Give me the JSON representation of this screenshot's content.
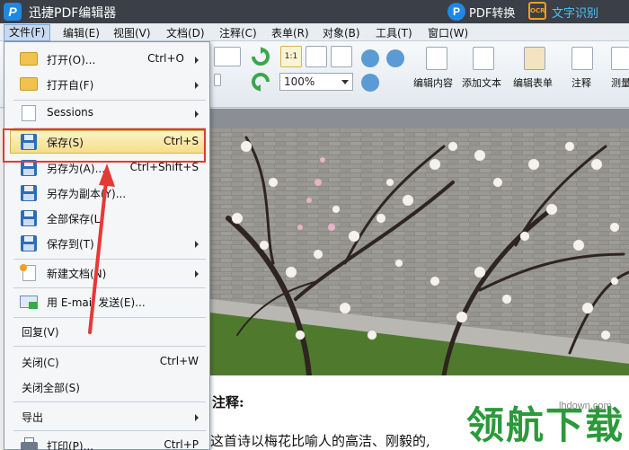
{
  "titlebar": {
    "app_title": "迅捷PDF编辑器",
    "logo_glyph": "P",
    "pdf_convert_label": "PDF转换",
    "pdf_convert_glyph": "P",
    "ocr_glyph": "OCR",
    "ocr_label": "文字识别"
  },
  "menubar": {
    "items": [
      "文件(F)",
      "编辑(E)",
      "视图(V)",
      "文档(D)",
      "注释(C)",
      "表单(R)",
      "对象(B)",
      "工具(T)",
      "窗口(W)"
    ]
  },
  "toolbar": {
    "zoom_value": "100%",
    "zoom_fit_label": "1:1",
    "edit_content_label": "编辑内容",
    "add_text_label": "添加文本",
    "edit_form_label": "编辑表单",
    "annotate_label": "注释",
    "measure_label": "测量"
  },
  "file_menu": {
    "items": [
      {
        "label": "打开(O)...",
        "shortcut": "Ctrl+O",
        "submenu": true
      },
      {
        "label": "打开自(F)",
        "shortcut": "",
        "submenu": true
      },
      {
        "label": "Sessions",
        "shortcut": "",
        "submenu": true
      },
      {
        "label": "保存(S)",
        "shortcut": "Ctrl+S",
        "submenu": false
      },
      {
        "label": "另存为(A)...",
        "shortcut": "Ctrl+Shift+S",
        "submenu": false
      },
      {
        "label": "另存为副本(Y)...",
        "shortcut": "",
        "submenu": false
      },
      {
        "label": "全部保存(L)",
        "shortcut": "",
        "submenu": false
      },
      {
        "label": "保存到(T)",
        "shortcut": "",
        "submenu": true
      },
      {
        "label": "新建文档(N)",
        "shortcut": "",
        "submenu": true
      },
      {
        "label": "用 E-mail 发送(E)...",
        "shortcut": "",
        "submenu": false
      },
      {
        "label": "回复(V)",
        "shortcut": "",
        "submenu": false
      },
      {
        "label": "关闭(C)",
        "shortcut": "Ctrl+W",
        "submenu": false
      },
      {
        "label": "关闭全部(S)",
        "shortcut": "",
        "submenu": false
      },
      {
        "label": "导出",
        "shortcut": "",
        "submenu": true
      },
      {
        "label": "打印(P)...",
        "shortcut": "Ctrl+P",
        "submenu": false
      }
    ]
  },
  "document": {
    "heading": "注释:",
    "text": "这首诗以梅花比喻人的高洁、刚毅的,"
  },
  "watermark": {
    "logo_text": "领航下载",
    "url": "lhdown.com"
  },
  "colors": {
    "titlebar_bg": "#3b3f47",
    "highlight_red": "#e53935",
    "watermark_green": "#2b9a3a",
    "accent_blue": "#1e88e5"
  }
}
